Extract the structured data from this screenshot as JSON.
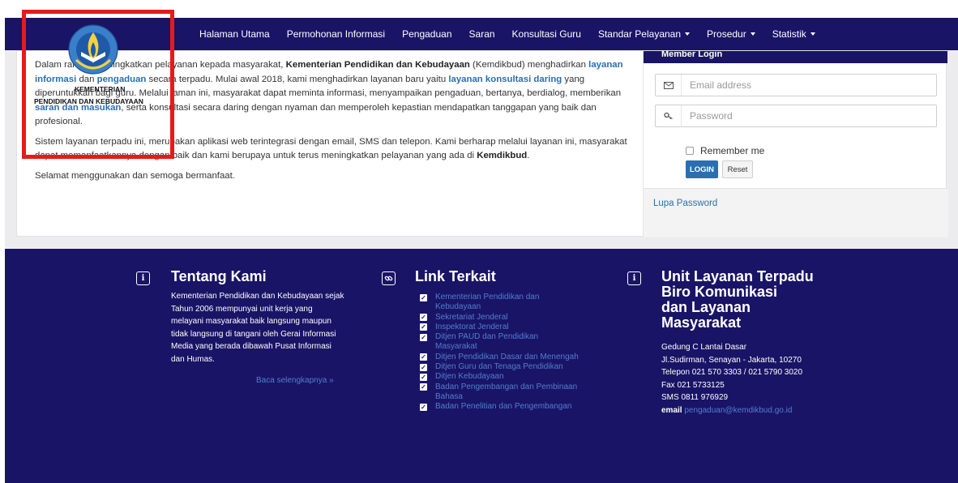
{
  "nav": {
    "items": [
      {
        "label": "Halaman Utama",
        "dropdown": false
      },
      {
        "label": "Permohonan Informasi",
        "dropdown": false
      },
      {
        "label": "Pengaduan",
        "dropdown": false
      },
      {
        "label": "Saran",
        "dropdown": false
      },
      {
        "label": "Konsultasi Guru",
        "dropdown": false
      },
      {
        "label": "Standar Pelayanan",
        "dropdown": true
      },
      {
        "label": "Prosedur",
        "dropdown": true
      },
      {
        "label": "Statistik",
        "dropdown": true
      }
    ]
  },
  "logo": {
    "line1": "KEMENTERIAN",
    "line2": "PENDIDIKAN DAN KEBUDAYAAN",
    "seal_text": "TUT WURI HANDAYANI"
  },
  "intro": {
    "p1": [
      {
        "t": "Dalam rangka meningkatkan pelayanan kepada masyarakat, ",
        "s": "n"
      },
      {
        "t": "Kementerian Pendidikan dan Kebudayaan",
        "s": "b"
      },
      {
        "t": " (Kemdikbud) menghadirkan ",
        "s": "n"
      },
      {
        "t": "layanan informasi",
        "s": "l"
      },
      {
        "t": " dan ",
        "s": "n"
      },
      {
        "t": "pengaduan",
        "s": "l"
      },
      {
        "t": " secara terpadu. Mulai awal 2018, kami menghadirkan layanan baru yaitu ",
        "s": "n"
      },
      {
        "t": "layanan konsultasi daring",
        "s": "l"
      },
      {
        "t": " yang diperuntukkan bagi guru. Melalui laman ini, masyarakat dapat meminta informasi, menyampaikan pengaduan, bertanya, berdialog, memberikan ",
        "s": "n"
      },
      {
        "t": "saran dan masukan",
        "s": "l"
      },
      {
        "t": ", serta konsultasi secara daring dengan nyaman dan memperoleh kepastian mendapatkan tanggapan yang baik dan profesional.",
        "s": "n"
      }
    ],
    "p2": [
      {
        "t": "Sistem layanan terpadu ini, merupakan aplikasi web terintegrasi dengan email, SMS dan telepon. Kami berharap melalui layanan ini, masyarakat dapat memanfaatkannya dengan baik dan kami berupaya untuk terus meningkatkan pelayanan yang ada di ",
        "s": "n"
      },
      {
        "t": "Kemdikbud",
        "s": "b"
      },
      {
        "t": ".",
        "s": "n"
      }
    ],
    "p3": "Selamat menggunakan dan semoga bermanfaat."
  },
  "login": {
    "header": "Member Login",
    "email_placeholder": "Email address",
    "password_placeholder": "Password",
    "remember_label": "Remember me",
    "login_button": "LOGIN",
    "reset_button": "Reset",
    "forgot_link": "Lupa Password",
    "email_icon": "envelope-icon",
    "password_icon": "key-icon"
  },
  "footer": {
    "about": {
      "icon": "info-icon",
      "title": "Tentang Kami",
      "text": "Kementerian Pendidikan dan Kebudayaan sejak Tahun 2006 mempunyai unit kerja yang melayani masyarakat baik langsung maupun tidak langsung di tangani oleh Gerai Informasi Media yang berada dibawah Pusat Informasi dan Humas.",
      "more": "Baca selengkapnya »"
    },
    "links": {
      "icon": "link-icon",
      "title": "Link Terkait",
      "items": [
        "Kementerian Pendidikan dan Kebudayaan",
        "Sekretariat Jenderal",
        "Inspektorat Jenderal",
        "Ditjen PAUD dan Pendidikan Masyarakat",
        "Ditjen Pendidikan Dasar dan Menengah",
        "Ditjen Guru dan Tenaga Pendidikan",
        "Ditjen Kebudayaan",
        "Badan Pengembangan dan Pembinaan Bahasa",
        "Badan Penelitian dan Pengembangan"
      ]
    },
    "unit": {
      "icon": "info-icon",
      "title_lines": [
        "Unit Layanan Terpadu",
        "Biro Komunikasi",
        "dan Layanan",
        "Masyarakat"
      ],
      "address1": "Gedung C Lantai Dasar",
      "address2": "Jl.Sudirman, Senayan - Jakarta, 10270",
      "phone": "Telepon 021 570 3303 / 021 5790 3020",
      "fax": "Fax 021 5733125",
      "sms": "SMS 0811 976929",
      "email_label": "email",
      "email": "pengaduan@kemdikbud.go.id"
    }
  },
  "colors": {
    "navy": "#1a1466",
    "link": "#2a6fb0",
    "footer_link": "#4f7fd0",
    "highlight": "#e51b1b"
  }
}
